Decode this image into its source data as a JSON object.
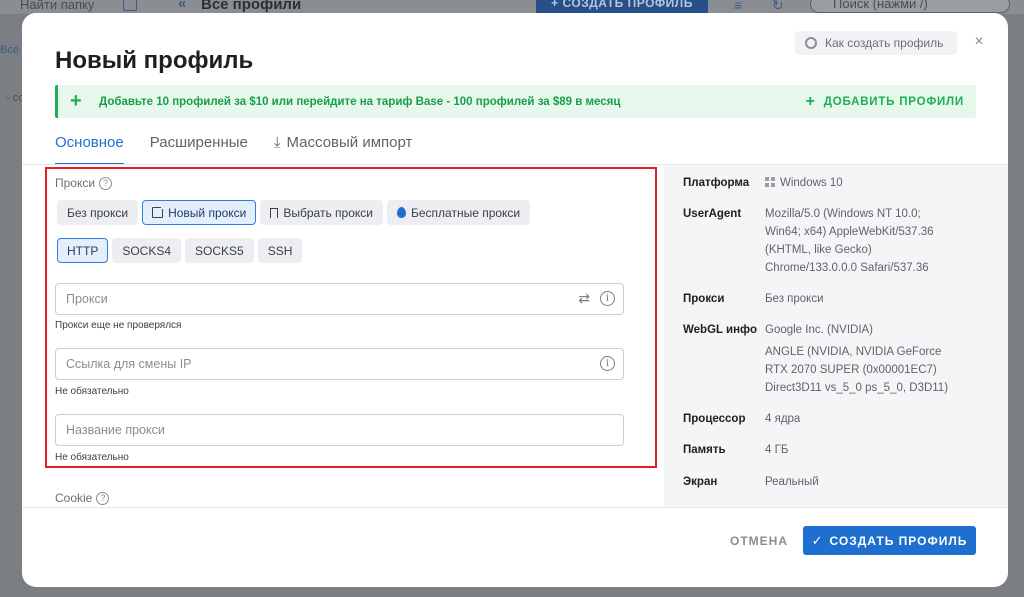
{
  "background": {
    "folder_search": "Найти папку",
    "header_title": "Все профили",
    "create_button": "+ СОЗДАТЬ ПРОФИЛЬ",
    "search_placeholder": "Поиск (нажми /)",
    "side_link": "Все",
    "side_text": "- со"
  },
  "modal": {
    "title": "Новый профиль",
    "howto_label": "Как создать профиль",
    "close_glyph": "×"
  },
  "promo": {
    "text": "Добавьте 10 профилей за $10 или перейдите на тариф Base - 100 профилей за $89 в месяц",
    "add_label": "ДОБАВИТЬ ПРОФИЛИ"
  },
  "tabs": [
    {
      "label": "Основное",
      "active": true
    },
    {
      "label": "Расширенные",
      "active": false
    },
    {
      "label": "Массовый импорт",
      "active": false
    }
  ],
  "proxy": {
    "section_label": "Прокси",
    "mode_buttons": [
      {
        "label": "Без прокси"
      },
      {
        "label": "Новый прокси",
        "selected": true
      },
      {
        "label": "Выбрать прокси"
      },
      {
        "label": "Бесплатные прокси"
      }
    ],
    "protocols": [
      {
        "label": "HTTP",
        "selected": true
      },
      {
        "label": "SOCKS4"
      },
      {
        "label": "SOCKS5"
      },
      {
        "label": "SSH"
      }
    ],
    "proxy_field": {
      "placeholder": "Прокси",
      "value": "",
      "hint": "Прокси еще не проверялся"
    },
    "change_ip_field": {
      "placeholder": "Ссылка для смены IP",
      "value": "",
      "hint": "Не обязательно"
    },
    "name_field": {
      "placeholder": "Название прокси",
      "value": "",
      "hint": "Не обязательно"
    }
  },
  "cookie": {
    "section_label": "Cookie"
  },
  "info_panel": [
    {
      "key": "Платформа",
      "value": "Windows 10"
    },
    {
      "key": "UserAgent",
      "value": "Mozilla/5.0 (Windows NT 10.0; Win64; x64) AppleWebKit/537.36 (KHTML, like Gecko) Chrome/133.0.0.0 Safari/537.36"
    },
    {
      "key": "Прокси",
      "value": "Без прокси"
    },
    {
      "key": "WebGL инфо",
      "value": "Google Inc. (NVIDIA)",
      "value2": "ANGLE (NVIDIA, NVIDIA GeForce RTX 2070 SUPER (0x00001EC7) Direct3D11 vs_5_0 ps_5_0, D3D11)"
    },
    {
      "key": "Процессор",
      "value": "4 ядра"
    },
    {
      "key": "Память",
      "value": "4 ГБ"
    },
    {
      "key": "Экран",
      "value": "Реальный"
    }
  ],
  "footer": {
    "cancel_label": "ОТМЕНА",
    "create_label": "СОЗДАТЬ ПРОФИЛЬ"
  },
  "colors": {
    "accent": "#1f6fd1",
    "promo_green": "#1fae55",
    "highlight_red": "#e0202a"
  }
}
